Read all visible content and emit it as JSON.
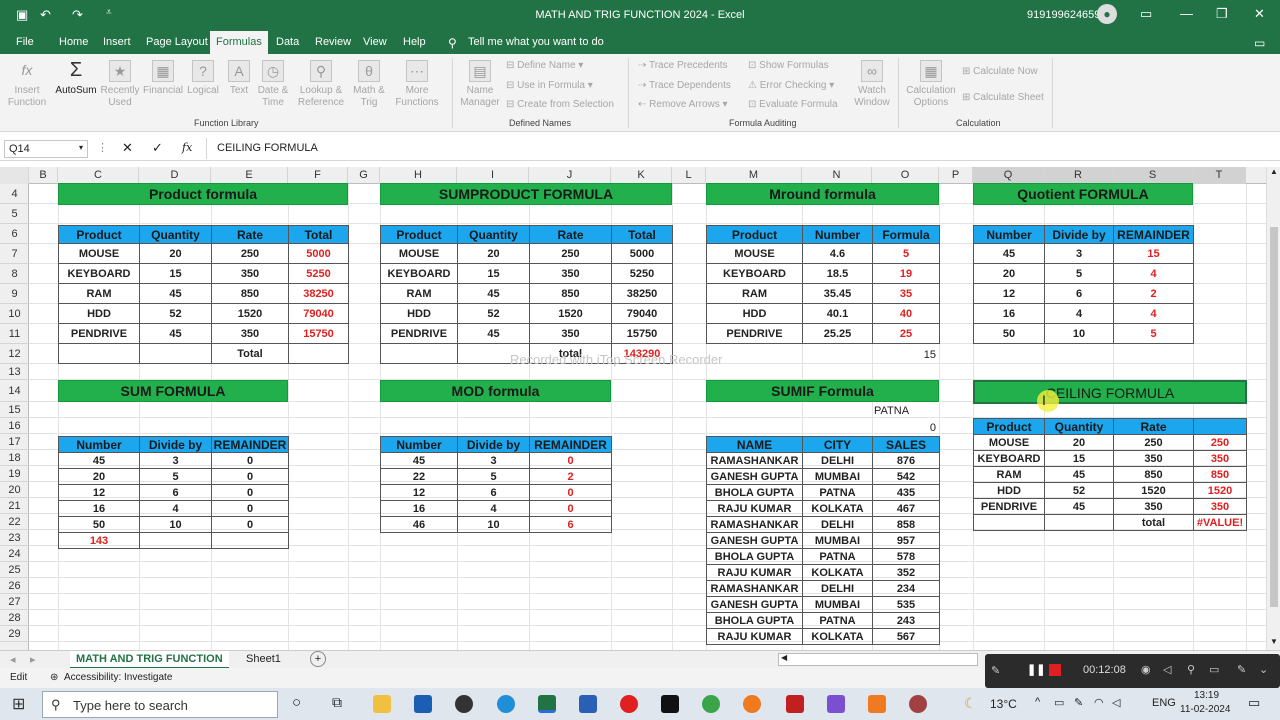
{
  "app": {
    "title": "MATH AND TRIG FUNCTION 2024  -  Excel",
    "account_phone": "919199624659"
  },
  "ribbon_tabs": [
    "File",
    "Home",
    "Insert",
    "Page Layout",
    "Formulas",
    "Data",
    "Review",
    "View",
    "Help"
  ],
  "tell_me": "Tell me what you want to do",
  "ribbon": {
    "insert_function": "Insert\nFunction",
    "autosum": "AutoSum",
    "recently_used": "Recently\nUsed",
    "financial": "Financial",
    "logical": "Logical",
    "text": "Text",
    "date_time": "Date &\nTime",
    "lookup": "Lookup &\nReference",
    "math_trig": "Math &\nTrig",
    "more_functions": "More\nFunctions",
    "function_library": "Function Library",
    "name_manager": "Name\nManager",
    "define_name": "Define Name",
    "use_in_formula": "Use in Formula",
    "create_from_selection": "Create from Selection",
    "defined_names": "Defined Names",
    "trace_precedents": "Trace Precedents",
    "trace_dependents": "Trace Dependents",
    "remove_arrows": "Remove Arrows",
    "show_formulas": "Show Formulas",
    "error_checking": "Error Checking",
    "evaluate_formula": "Evaluate Formula",
    "watch_window": "Watch\nWindow",
    "formula_auditing": "Formula Auditing",
    "calculation_options": "Calculation\nOptions",
    "calculate_now": "Calculate Now",
    "calculate_sheet": "Calculate Sheet",
    "calculation": "Calculation"
  },
  "formula_bar": {
    "name_box": "Q14",
    "fx": "fx",
    "value": "CEILING FORMULA"
  },
  "columns": [
    "B",
    "C",
    "D",
    "E",
    "F",
    "G",
    "H",
    "I",
    "J",
    "K",
    "L",
    "M",
    "N",
    "O",
    "P",
    "Q",
    "R",
    "S",
    "T"
  ],
  "rows": [
    "4",
    "5",
    "6",
    "7",
    "8",
    "9",
    "10",
    "11",
    "12",
    "13",
    "14",
    "15",
    "16",
    "17",
    "18",
    "19",
    "20",
    "21",
    "22",
    "23",
    "24",
    "25",
    "26",
    "27",
    "28",
    "29"
  ],
  "sections": {
    "product": {
      "title": "Product formula",
      "headers": [
        "Product",
        "Quantity",
        "Rate",
        "Total"
      ],
      "rows": [
        [
          "MOUSE",
          "20",
          "250",
          "5000"
        ],
        [
          "KEYBOARD",
          "15",
          "350",
          "5250"
        ],
        [
          "RAM",
          "45",
          "850",
          "38250"
        ],
        [
          "HDD",
          "52",
          "1520",
          "79040"
        ],
        [
          "PENDRIVE",
          "45",
          "350",
          "15750"
        ],
        [
          "",
          "",
          "Total",
          ""
        ]
      ]
    },
    "sumproduct": {
      "title": "SUMPRODUCT FORMULA",
      "headers": [
        "Product",
        "Quantity",
        "Rate",
        "Total"
      ],
      "rows": [
        [
          "MOUSE",
          "20",
          "250",
          "5000"
        ],
        [
          "KEYBOARD",
          "15",
          "350",
          "5250"
        ],
        [
          "RAM",
          "45",
          "850",
          "38250"
        ],
        [
          "HDD",
          "52",
          "1520",
          "79040"
        ],
        [
          "PENDRIVE",
          "45",
          "350",
          "15750"
        ],
        [
          "",
          "",
          "total",
          "143290"
        ]
      ]
    },
    "mround": {
      "title": "Mround formula",
      "headers": [
        "Product",
        "Number",
        "Formula"
      ],
      "rows": [
        [
          "MOUSE",
          "4.6",
          "5"
        ],
        [
          "KEYBOARD",
          "18.5",
          "19"
        ],
        [
          "RAM",
          "35.45",
          "35"
        ],
        [
          "HDD",
          "40.1",
          "40"
        ],
        [
          "PENDRIVE",
          "25.25",
          "25"
        ]
      ],
      "extra": "15"
    },
    "quotient": {
      "title": "Quotient FORMULA",
      "headers": [
        "Number",
        "Divide by",
        "REMAINDER"
      ],
      "rows": [
        [
          "45",
          "3",
          "15"
        ],
        [
          "20",
          "5",
          "4"
        ],
        [
          "12",
          "6",
          "2"
        ],
        [
          "16",
          "4",
          "4"
        ],
        [
          "50",
          "10",
          "5"
        ]
      ]
    },
    "sum": {
      "title": "SUM FORMULA",
      "headers": [
        "Number",
        "Divide by",
        "REMAINDER"
      ],
      "rows": [
        [
          "45",
          "3",
          "0"
        ],
        [
          "20",
          "5",
          "0"
        ],
        [
          "12",
          "6",
          "0"
        ],
        [
          "16",
          "4",
          "0"
        ],
        [
          "50",
          "10",
          "0"
        ],
        [
          "143",
          "",
          ""
        ]
      ]
    },
    "mod": {
      "title": "MOD formula",
      "headers": [
        "Number",
        "Divide by",
        "REMAINDER"
      ],
      "rows": [
        [
          "45",
          "3",
          "0"
        ],
        [
          "22",
          "5",
          "2"
        ],
        [
          "12",
          "6",
          "0"
        ],
        [
          "16",
          "4",
          "0"
        ],
        [
          "46",
          "10",
          "6"
        ]
      ]
    },
    "sumif": {
      "title": "SUMIF Formula",
      "criteria": "PATNA",
      "result": "0",
      "headers": [
        "NAME",
        "CITY",
        "SALES"
      ],
      "rows": [
        [
          "RAMASHANKAR",
          "DELHI",
          "876"
        ],
        [
          "GANESH GUPTA",
          "MUMBAI",
          "542"
        ],
        [
          "BHOLA GUPTA",
          "PATNA",
          "435"
        ],
        [
          "RAJU KUMAR",
          "KOLKATA",
          "467"
        ],
        [
          "RAMASHANKAR",
          "DELHI",
          "858"
        ],
        [
          "GANESH GUPTA",
          "MUMBAI",
          "957"
        ],
        [
          "BHOLA GUPTA",
          "PATNA",
          "578"
        ],
        [
          "RAJU KUMAR",
          "KOLKATA",
          "352"
        ],
        [
          "RAMASHANKAR",
          "DELHI",
          "234"
        ],
        [
          "GANESH GUPTA",
          "MUMBAI",
          "535"
        ],
        [
          "BHOLA GUPTA",
          "PATNA",
          "243"
        ],
        [
          "RAJU KUMAR",
          "KOLKATA",
          "567"
        ]
      ]
    },
    "ceiling": {
      "title": "CEILING FORMULA",
      "headers": [
        "Product",
        "Quantity",
        "Rate",
        ""
      ],
      "rows": [
        [
          "MOUSE",
          "20",
          "250",
          "250"
        ],
        [
          "KEYBOARD",
          "15",
          "350",
          "350"
        ],
        [
          "RAM",
          "45",
          "850",
          "850"
        ],
        [
          "HDD",
          "52",
          "1520",
          "1520"
        ],
        [
          "PENDRIVE",
          "45",
          "350",
          "350"
        ],
        [
          "",
          "",
          "total",
          "#VALUE!"
        ]
      ]
    }
  },
  "watermark": "Recorded with iTop Screen Recorder",
  "sheet_tabs": [
    "MATH AND TRIG FUNCTION",
    "Sheet1"
  ],
  "status": {
    "mode": "Edit",
    "accessibility": "Accessibility: Investigate"
  },
  "recorder": {
    "time": "00:12:08"
  },
  "taskbar": {
    "search_placeholder": "Type here to search",
    "weather": "13°C",
    "lang": "ENG",
    "time": "13:19",
    "date": "11-02-2024"
  },
  "colors": {
    "excel_green": "#217346",
    "title_green": "#21b04b",
    "header_blue": "#1ba6ee",
    "value_red": "#e02020"
  }
}
